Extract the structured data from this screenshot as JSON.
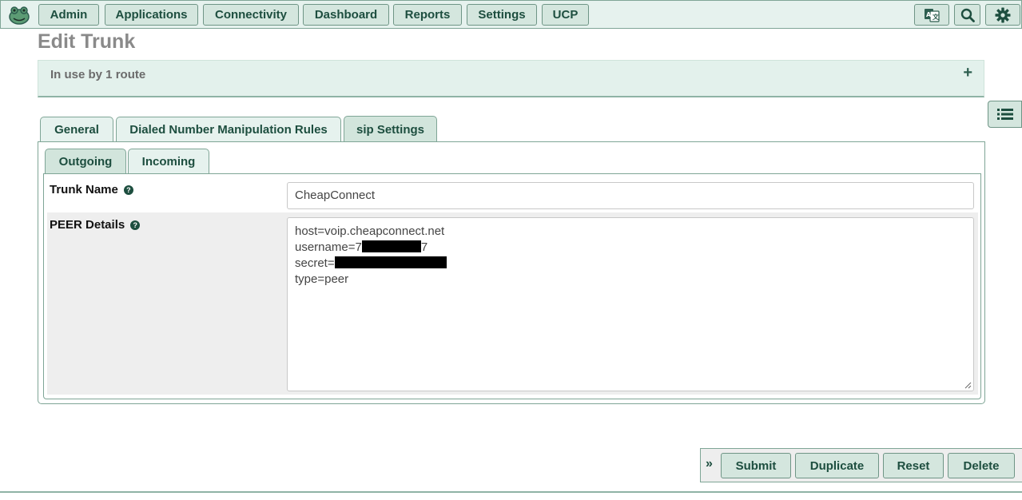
{
  "nav": {
    "items": [
      "Admin",
      "Applications",
      "Connectivity",
      "Dashboard",
      "Reports",
      "Settings",
      "UCP"
    ]
  },
  "header": {
    "icons": [
      "language-icon",
      "search-icon",
      "gear-icon"
    ]
  },
  "page": {
    "title": "Edit Trunk"
  },
  "inuse": {
    "text": "In use by 1 route",
    "toggle": "+"
  },
  "tabs": {
    "general": "General",
    "dialed": "Dialed Number Manipulation Rules",
    "sip": "sip Settings"
  },
  "subtabs": {
    "outgoing": "Outgoing",
    "incoming": "Incoming"
  },
  "form": {
    "trunk_name_label": "Trunk Name",
    "trunk_name_value": "CheapConnect",
    "peer_label": "PEER Details",
    "peer_lines": {
      "host": "host=voip.cheapconnect.net",
      "username_prefix": "username=7",
      "username_suffix": "7",
      "secret_prefix": "secret=",
      "type": "type=peer"
    },
    "help_glyph": "?"
  },
  "actions": {
    "chevron": "»",
    "submit": "Submit",
    "duplicate": "Duplicate",
    "reset": "Reset",
    "delete": "Delete"
  },
  "colors": {
    "accent": "#1d4e3f",
    "button_bg": "#d4e6de",
    "panel_bg": "#e3f1ec"
  }
}
